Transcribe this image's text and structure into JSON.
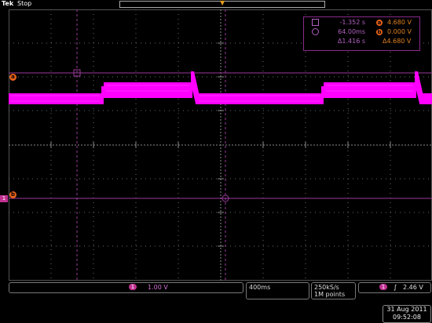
{
  "header": {
    "brand": "Tek",
    "status": "Stop",
    "trigger_icon": "trigger-position-arrow"
  },
  "readouts": {
    "cursor_a_time": "-1.352 s",
    "cursor_a_volt": "4.680 V",
    "cursor_b_time": "64.00ms",
    "cursor_b_volt": "0.000 V",
    "delta_time": "Δ1.416 s",
    "delta_volt": "Δ4.680 V",
    "cursor_a_label": "a",
    "cursor_b_label": "b"
  },
  "channel": {
    "number": "1",
    "scale": "1.00 V",
    "color": "#ff00ff",
    "marker_label": "1"
  },
  "cursor_markers": {
    "a_label": "a",
    "b_label": "b"
  },
  "timebase": {
    "horizontal": "400ms",
    "sample_rate": "250kS/s",
    "record_length": "1M points"
  },
  "trigger": {
    "channel": "1",
    "slope_icon": "rising-edge-icon",
    "level": "2.46 V"
  },
  "datetime": {
    "date": "31 Aug 2011",
    "time": "09:52:08"
  },
  "colors": {
    "trace": "#ff00ff",
    "cursor": "#9a3a9a",
    "grid": "#6a6a6a",
    "badge": "#e8621a"
  }
}
